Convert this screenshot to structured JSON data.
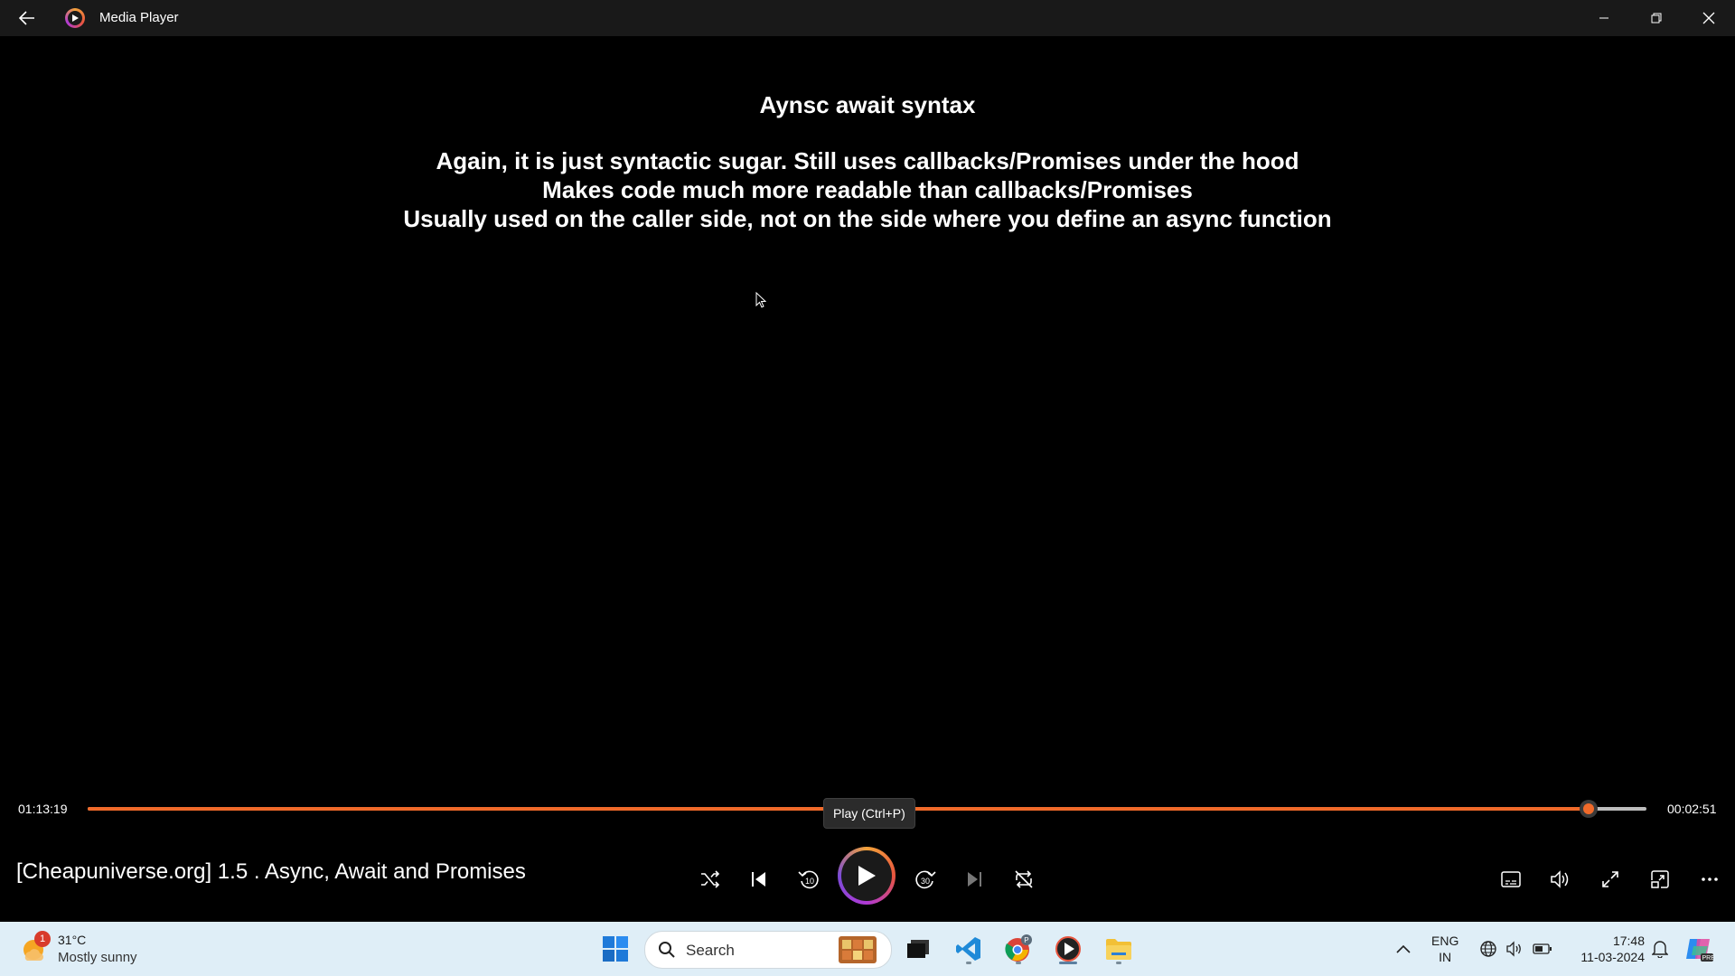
{
  "window": {
    "title": "Media Player"
  },
  "slide": {
    "title": "Aynsc await syntax",
    "lines": [
      "Again, it is just syntactic sugar. Still uses callbacks/Promises under the hood",
      "Makes code much more readable than callbacks/Promises",
      "Usually used on the caller side, not on the side where you define an async function"
    ]
  },
  "player": {
    "elapsed": "01:13:19",
    "remaining": "00:02:51",
    "progress": 0.963,
    "tooltip": "Play (Ctrl+P)",
    "media_title": "[Cheapuniverse.org] 1.5 . Async, Await and Promises",
    "accent_color": "#f06a2a"
  },
  "taskbar": {
    "weather_badge": "1",
    "weather_temp": "31°C",
    "weather_desc": "Mostly sunny",
    "search_placeholder": "Search",
    "lang_line1": "ENG",
    "lang_line2": "IN",
    "time": "17:48",
    "date": "11-03-2024"
  }
}
